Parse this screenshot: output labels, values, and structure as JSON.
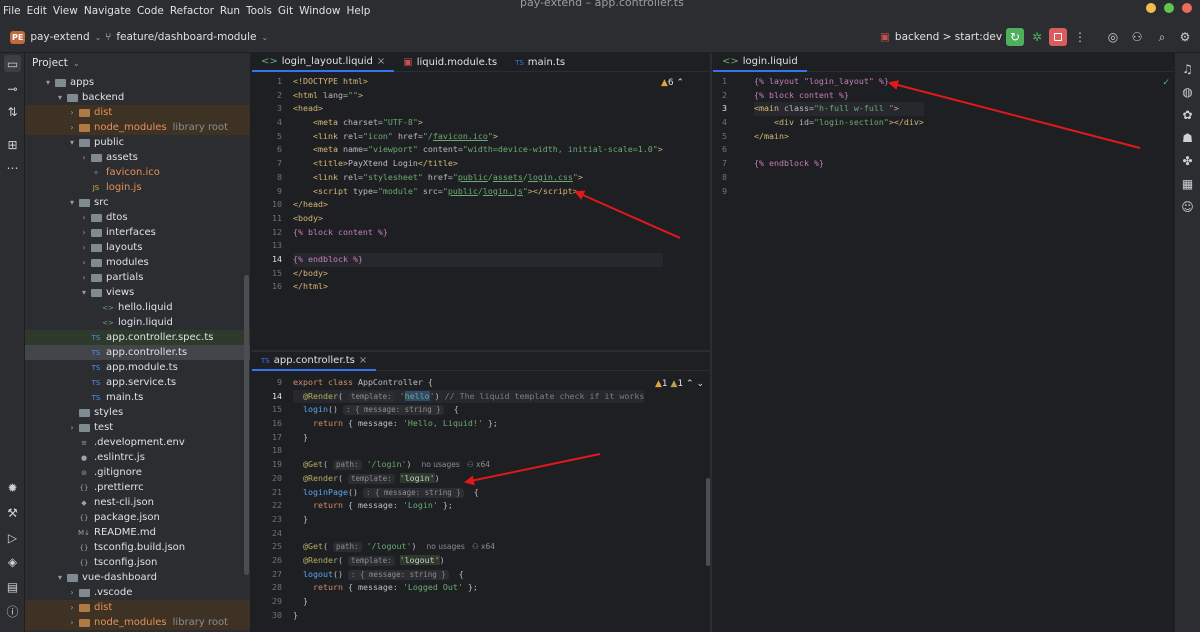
{
  "menu": [
    "File",
    "Edit",
    "View",
    "Navigate",
    "Code",
    "Refactor",
    "Run",
    "Tools",
    "Git",
    "Window",
    "Help"
  ],
  "window_title": "pay-extend – app.controller.ts",
  "toolbar": {
    "project_badge": "PE",
    "project_name": "pay-extend",
    "branch": "feature/dashboard-module",
    "run_config": "backend > start:dev"
  },
  "project_panel": {
    "title": "Project",
    "items": [
      {
        "label": "apps",
        "depth": 1,
        "arrow": "▾",
        "kind": "folder"
      },
      {
        "label": "backend",
        "depth": 2,
        "arrow": "▾",
        "kind": "folder"
      },
      {
        "label": "dist",
        "depth": 3,
        "arrow": "›",
        "kind": "folder",
        "ex": true,
        "color": "#e8915a"
      },
      {
        "label": "node_modules",
        "depth": 3,
        "arrow": "›",
        "kind": "folder",
        "ex": true,
        "color": "#e8915a",
        "note": "library root"
      },
      {
        "label": "public",
        "depth": 3,
        "arrow": "▾",
        "kind": "folder"
      },
      {
        "label": "assets",
        "depth": 4,
        "arrow": "›",
        "kind": "folder"
      },
      {
        "label": "favicon.ico",
        "depth": 4,
        "kind": "file",
        "color": "#e8915a",
        "icon": "✧"
      },
      {
        "label": "login.js",
        "depth": 4,
        "kind": "file",
        "color": "#e8915a",
        "icon": "JS"
      },
      {
        "label": "src",
        "depth": 3,
        "arrow": "▾",
        "kind": "folder"
      },
      {
        "label": "dtos",
        "depth": 4,
        "arrow": "›",
        "kind": "folder"
      },
      {
        "label": "interfaces",
        "depth": 4,
        "arrow": "›",
        "kind": "folder"
      },
      {
        "label": "layouts",
        "depth": 4,
        "arrow": "›",
        "kind": "folder"
      },
      {
        "label": "modules",
        "depth": 4,
        "arrow": "›",
        "kind": "folder"
      },
      {
        "label": "partials",
        "depth": 4,
        "arrow": "›",
        "kind": "folder"
      },
      {
        "label": "views",
        "depth": 4,
        "arrow": "▾",
        "kind": "folder"
      },
      {
        "label": "hello.liquid",
        "depth": 5,
        "kind": "file",
        "icon": "<>"
      },
      {
        "label": "login.liquid",
        "depth": 5,
        "kind": "file",
        "icon": "<>"
      },
      {
        "label": "app.controller.spec.ts",
        "depth": 4,
        "kind": "file",
        "icon": "TS",
        "hi": true
      },
      {
        "label": "app.controller.ts",
        "depth": 4,
        "kind": "file",
        "icon": "TS",
        "sel": true
      },
      {
        "label": "app.module.ts",
        "depth": 4,
        "kind": "file",
        "icon": "TS"
      },
      {
        "label": "app.service.ts",
        "depth": 4,
        "kind": "file",
        "icon": "TS"
      },
      {
        "label": "main.ts",
        "depth": 4,
        "kind": "file",
        "icon": "TS"
      },
      {
        "label": "styles",
        "depth": 3,
        "kind": "folder"
      },
      {
        "label": "test",
        "depth": 3,
        "arrow": "›",
        "kind": "folder"
      },
      {
        "label": ".development.env",
        "depth": 3,
        "kind": "file",
        "icon": "≡"
      },
      {
        "label": ".eslintrc.js",
        "depth": 3,
        "kind": "file",
        "icon": "●"
      },
      {
        "label": ".gitignore",
        "depth": 3,
        "kind": "file",
        "icon": "⊘"
      },
      {
        "label": ".prettierrc",
        "depth": 3,
        "kind": "file",
        "icon": "{}"
      },
      {
        "label": "nest-cli.json",
        "depth": 3,
        "kind": "file",
        "icon": "◆"
      },
      {
        "label": "package.json",
        "depth": 3,
        "kind": "file",
        "icon": "{}"
      },
      {
        "label": "README.md",
        "depth": 3,
        "kind": "file",
        "icon": "M↓"
      },
      {
        "label": "tsconfig.build.json",
        "depth": 3,
        "kind": "file",
        "icon": "{}"
      },
      {
        "label": "tsconfig.json",
        "depth": 3,
        "kind": "file",
        "icon": "{}"
      },
      {
        "label": "vue-dashboard",
        "depth": 2,
        "arrow": "▾",
        "kind": "folder"
      },
      {
        "label": ".vscode",
        "depth": 3,
        "arrow": "›",
        "kind": "folder"
      },
      {
        "label": "dist",
        "depth": 3,
        "arrow": "›",
        "kind": "folder",
        "ex": true,
        "color": "#e8915a"
      },
      {
        "label": "node_modules",
        "depth": 3,
        "arrow": "›",
        "kind": "folder",
        "ex": true,
        "color": "#e8915a",
        "note": "library root"
      }
    ]
  },
  "editor_left_tabs": [
    "login_layout.liquid",
    "liquid.module.ts",
    "main.ts"
  ],
  "editor_right_tabs": [
    "login.liquid"
  ],
  "editor_bottom_tabs": [
    "app.controller.ts"
  ],
  "left_warnings": "6",
  "bottom_warnings": {
    "warn": "1",
    "weak": "1"
  },
  "layout_code": [
    {
      "n": "1",
      "h": "<span class=t>&lt;!DOCTYPE html&gt;</span>"
    },
    {
      "n": "2",
      "h": "<span class=t>&lt;html</span> <span class=a>lang=</span><span class=s>\"\"</span><span class=t>&gt;</span>"
    },
    {
      "n": "3",
      "h": "<span class=t>&lt;head&gt;</span>"
    },
    {
      "n": "4",
      "h": "    <span class=t>&lt;meta</span> <span class=a>charset=</span><span class=s>\"UTF-8\"</span><span class=t>&gt;</span>"
    },
    {
      "n": "5",
      "h": "    <span class=t>&lt;link</span> <span class=a>rel=</span><span class=s>\"icon\"</span> <span class=a>href=</span><span class=s>\"/<u>favicon.ico</u>\"</span><span class=t>&gt;</span>"
    },
    {
      "n": "6",
      "h": "    <span class=t>&lt;meta</span> <span class=a>name=</span><span class=s>\"viewport\"</span> <span class=a>content=</span><span class=s>\"width=device-width, initial-scale=1.0\"</span><span class=t>&gt;</span>"
    },
    {
      "n": "7",
      "h": "    <span class=t>&lt;title&gt;</span>PayXtend Login<span class=t>&lt;/title&gt;</span>"
    },
    {
      "n": "8",
      "h": "    <span class=t>&lt;link</span> <span class=a>rel=</span><span class=s>\"stylesheet\"</span> <span class=a>href=</span><span class=s>\"<u>public</u>/<u>assets</u>/<u>login.css</u>\"</span><span class=t>&gt;</span>"
    },
    {
      "n": "9",
      "h": "    <span class=t>&lt;script</span> <span class=a>type=</span><span class=s>\"module\"</span> <span class=a>src=</span><span class=s>\"<u>public</u>/<u>login.js</u>\"</span><span class=t>&gt;&lt;/script&gt;</span>"
    },
    {
      "n": "10",
      "h": "<span class=t>&lt;/head&gt;</span>"
    },
    {
      "n": "11",
      "h": "<span class=t>&lt;body&gt;</span>"
    },
    {
      "n": "12",
      "h": "<span class=lq>{% block content %}</span>"
    },
    {
      "n": "13",
      "h": ""
    },
    {
      "n": "14",
      "h": "<span class=lq>{% endblock %}</span>",
      "cur": true
    },
    {
      "n": "15",
      "h": "<span class=t>&lt;/body&gt;</span>"
    },
    {
      "n": "16",
      "h": "<span class=t>&lt;/html&gt;</span>"
    }
  ],
  "login_code": [
    {
      "n": "1",
      "h": "<span class=lq>{% layout \"login_layout\" %}</span>"
    },
    {
      "n": "2",
      "h": "<span class=lq>{% block content %}</span>"
    },
    {
      "n": "3",
      "h": "<span class=t>&lt;main</span> <span class=a>class=</span><span class=s>\"h-full w-full \"</span><span class=t>&gt;</span>",
      "cur": true
    },
    {
      "n": "4",
      "h": "    <span class=t>&lt;div</span> <span class=a>id=</span><span class=s>\"login-section\"</span><span class=t>&gt;&lt;/div&gt;</span>"
    },
    {
      "n": "5",
      "h": "<span class=t>&lt;/main&gt;</span>"
    },
    {
      "n": "6",
      "h": ""
    },
    {
      "n": "7",
      "h": "<span class=lq>{% endblock %}</span>"
    },
    {
      "n": "8",
      "h": ""
    },
    {
      "n": "9",
      "h": ""
    }
  ],
  "controller_code": [
    {
      "n": "9",
      "h": "<span class=k>export class</span> AppController {"
    },
    {
      "n": "14",
      "h": "  <span class=d>@Render</span>( <span class=hint>template:</span> <span class=s>'<span class=hlword>hello</span>'</span>) <span class=c>// The liquid template check if it works</span>",
      "cur": true
    },
    {
      "n": "15",
      "h": "  <span class=f>login</span>() <span class=hint>: { message: string }</span>  {"
    },
    {
      "n": "16",
      "h": "    <span class=k>return</span> { message: <span class=s>'Hello, Liquid!'</span> };"
    },
    {
      "n": "17",
      "h": "  }"
    },
    {
      "n": "18",
      "h": ""
    },
    {
      "n": "19",
      "h": "  <span class=d>@Get</span>( <span class=hint>path:</span> <span class=s>'/login'</span>)  <span class=lbl>no usages   ⚇ x64</span>"
    },
    {
      "n": "20",
      "h": "  <span class=d>@Render</span>( <span class=hint>template:</span> <span class=s>'login'</span>)"
    },
    {
      "n": "21",
      "h": "  <span class=f>loginPage</span>() <span class=hint>: { message: string }</span>  {"
    },
    {
      "n": "22",
      "h": "    <span class=k>return</span> { message: <span class=s>'Login'</span> };"
    },
    {
      "n": "23",
      "h": "  }"
    },
    {
      "n": "24",
      "h": ""
    },
    {
      "n": "25",
      "h": "  <span class=d>@Get</span>( <span class=hint>path:</span> <span class=s>'/logout'</span>)  <span class=lbl>no usages   ⚇ x64</span>"
    },
    {
      "n": "26",
      "h": "  <span class=d>@Render</span>( <span class=hint>template:</span> <span class=s>'logout'</span>)"
    },
    {
      "n": "27",
      "h": "  <span class=f>logout</span>() <span class=hint>: { message: string }</span>  {"
    },
    {
      "n": "28",
      "h": "    <span class=k>return</span> { message: <span class=s>'Logged Out'</span> };"
    },
    {
      "n": "29",
      "h": "  }"
    },
    {
      "n": "30",
      "h": "}"
    }
  ],
  "colors": {
    "accent": "#3574f0",
    "annotation_arrow": "#e0191c",
    "run_green": "#4eb05b",
    "stop_red": "#db5c5c"
  },
  "icons": [
    "folder-icon",
    "commit-icon",
    "pull-request-icon",
    "structure-icon",
    "more-icon",
    "hammer-icon",
    "build-icon",
    "run-icon",
    "terminal-icon",
    "problems-icon",
    "git-icon",
    "debug-icon",
    "search-icon",
    "gear-icon",
    "add-user-icon",
    "copilot-icon"
  ]
}
